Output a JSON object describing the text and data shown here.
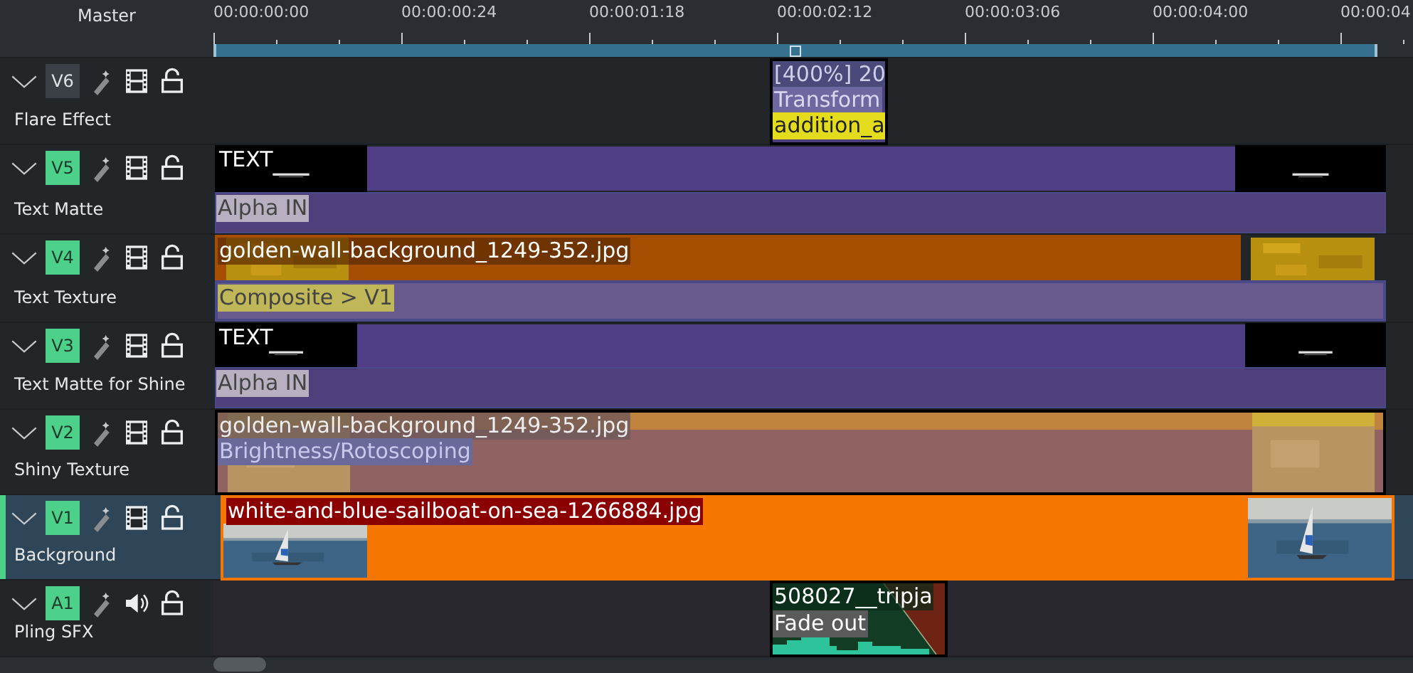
{
  "ruler": {
    "label": "Master",
    "timecodes": [
      "00:00:00:00",
      "00:00:00:24",
      "00:00:01:18",
      "00:00:02:12",
      "00:00:03:06",
      "00:00:04:00",
      "00:00:04"
    ]
  },
  "tracks": [
    {
      "kind": "video",
      "badge": "V6",
      "active": false,
      "selected": false,
      "name": "Flare Effect",
      "clips": [
        {
          "kind": "effect-stack",
          "title": "[400%] 20",
          "effect": "Transform",
          "marker": "addition_a"
        }
      ]
    },
    {
      "kind": "video",
      "badge": "V5",
      "active": true,
      "selected": false,
      "name": "Text Matte",
      "clips": [
        {
          "kind": "title",
          "title": "TEXT"
        }
      ],
      "composition": "Alpha IN"
    },
    {
      "kind": "video",
      "badge": "V4",
      "active": true,
      "selected": false,
      "name": "Text Texture",
      "clips": [
        {
          "title": "golden-wall-background_1249-352.jpg"
        },
        {
          "kind": "image-tail"
        }
      ],
      "composition": "Composite > V1"
    },
    {
      "kind": "video",
      "badge": "V3",
      "active": true,
      "selected": false,
      "name": "Text Matte for Shine",
      "clips": [
        {
          "kind": "title",
          "title": "TEXT"
        }
      ],
      "composition": "Alpha IN"
    },
    {
      "kind": "video",
      "badge": "V2",
      "active": true,
      "selected": false,
      "name": "Shiny Texture",
      "clips": [
        {
          "kind": "effect-image",
          "title": "golden-wall-background_1249-352.jpg",
          "effect": "Brightness/Rotoscoping"
        }
      ]
    },
    {
      "kind": "video",
      "badge": "V1",
      "active": true,
      "selected": true,
      "name": "Background",
      "clips": [
        {
          "title": "white-and-blue-sailboat-on-sea-1266884.jpg"
        }
      ]
    },
    {
      "kind": "audio",
      "badge": "A1",
      "active": true,
      "selected": false,
      "name": "Pling SFX",
      "clips": [
        {
          "kind": "audio",
          "title": "508027__tripja",
          "effect": "Fade out"
        }
      ]
    }
  ]
}
